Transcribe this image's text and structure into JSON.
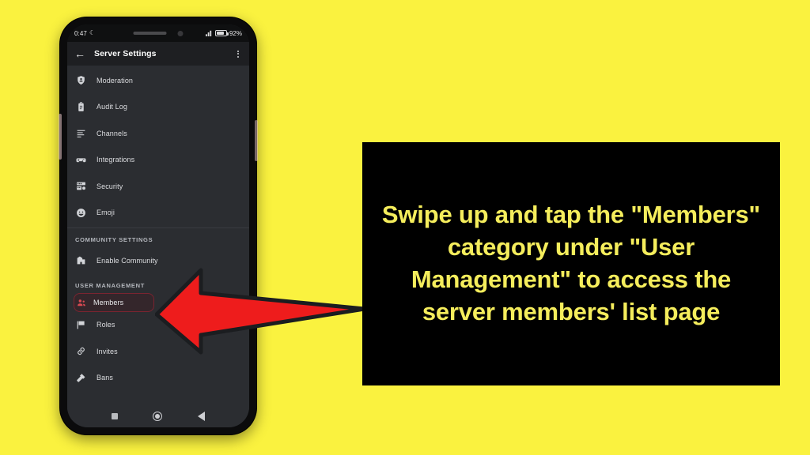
{
  "background_color": "#FAF23F",
  "phone": {
    "status_bar": {
      "time": "0:47",
      "dnd_icon": "crescent-moon-icon",
      "signal_icon": "cellular-signal-icon",
      "battery_icon": "battery-icon",
      "battery_percent": "92%"
    },
    "header": {
      "back_icon": "back-arrow-icon",
      "title": "Server Settings",
      "overflow_icon": "overflow-menu-icon"
    },
    "settings_list": [
      {
        "type": "item",
        "label": "Moderation",
        "icon": "shield-icon"
      },
      {
        "type": "item",
        "label": "Audit Log",
        "icon": "clipboard-icon"
      },
      {
        "type": "item",
        "label": "Channels",
        "icon": "channel-lines-icon"
      },
      {
        "type": "item",
        "label": "Integrations",
        "icon": "game-controller-icon"
      },
      {
        "type": "item",
        "label": "Security",
        "icon": "security-panel-icon"
      },
      {
        "type": "item",
        "label": "Emoji",
        "icon": "emoji-face-icon"
      },
      {
        "type": "section",
        "label": "COMMUNITY SETTINGS"
      },
      {
        "type": "item",
        "label": "Enable Community",
        "icon": "community-building-icon"
      },
      {
        "type": "section",
        "label": "USER MANAGEMENT"
      },
      {
        "type": "item",
        "label": "Members",
        "icon": "members-people-icon",
        "highlighted": true
      },
      {
        "type": "item",
        "label": "Roles",
        "icon": "flag-icon"
      },
      {
        "type": "item",
        "label": "Invites",
        "icon": "link-icon"
      },
      {
        "type": "item",
        "label": "Bans",
        "icon": "hammer-icon"
      }
    ],
    "nav_bar": {
      "recents_icon": "recents-square-icon",
      "home_icon": "home-circle-icon",
      "back_icon": "back-triangle-icon"
    },
    "highlight_border_color": "#7a2430",
    "highlight_icon_color": "#d94a52"
  },
  "annotation": {
    "arrow_icon": "red-left-arrow-icon",
    "arrow_color": "#EE1C1C",
    "arrow_outline_color": "#1b1d20"
  },
  "caption": {
    "text": "Swipe up and tap the \"Members\" category under \"User Management\" to access the server members' list page",
    "text_color": "#F5ED5C",
    "panel_color": "#000000"
  }
}
